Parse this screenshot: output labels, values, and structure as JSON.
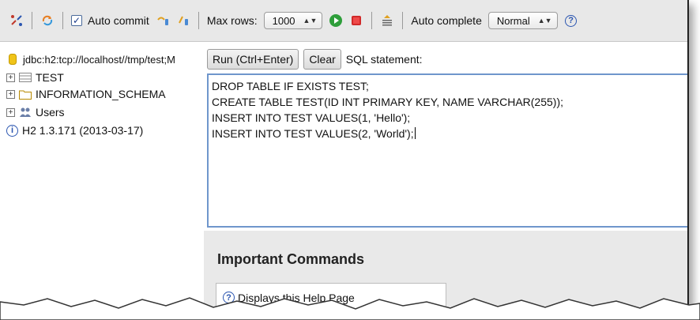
{
  "toolbar": {
    "auto_commit_label": "Auto commit",
    "auto_commit_checked": true,
    "max_rows_label": "Max rows:",
    "max_rows_value": "1000",
    "auto_complete_label": "Auto complete",
    "auto_complete_value": "Normal",
    "help_glyph": "?"
  },
  "tree": {
    "connection": "jdbc:h2:tcp://localhost//tmp/test;M",
    "items": [
      {
        "label": "TEST",
        "icon": "table-icon"
      },
      {
        "label": "INFORMATION_SCHEMA",
        "icon": "folder-icon"
      },
      {
        "label": "Users",
        "icon": "users-icon"
      }
    ],
    "version": "H2 1.3.171 (2013-03-17)"
  },
  "query": {
    "run_label": "Run (Ctrl+Enter)",
    "clear_label": "Clear",
    "sql_label": "SQL statement:",
    "lines": [
      "DROP TABLE IF EXISTS TEST;",
      "CREATE TABLE TEST(ID INT PRIMARY KEY, NAME VARCHAR(255));",
      "INSERT INTO TEST VALUES(1, 'Hello');",
      "INSERT INTO TEST VALUES(2, 'World');"
    ]
  },
  "result": {
    "title": "Important Commands",
    "help_row": "Displays this Help Page"
  },
  "colors": {
    "toolbar_bg": "#e8e8e8",
    "editor_border": "#6f96cc",
    "result_bg": "#e9e9e9",
    "run_green": "#2e9e3a",
    "stop_red": "#d12a2a",
    "db_yellow": "#f0c419",
    "help_blue": "#2a55b0"
  }
}
